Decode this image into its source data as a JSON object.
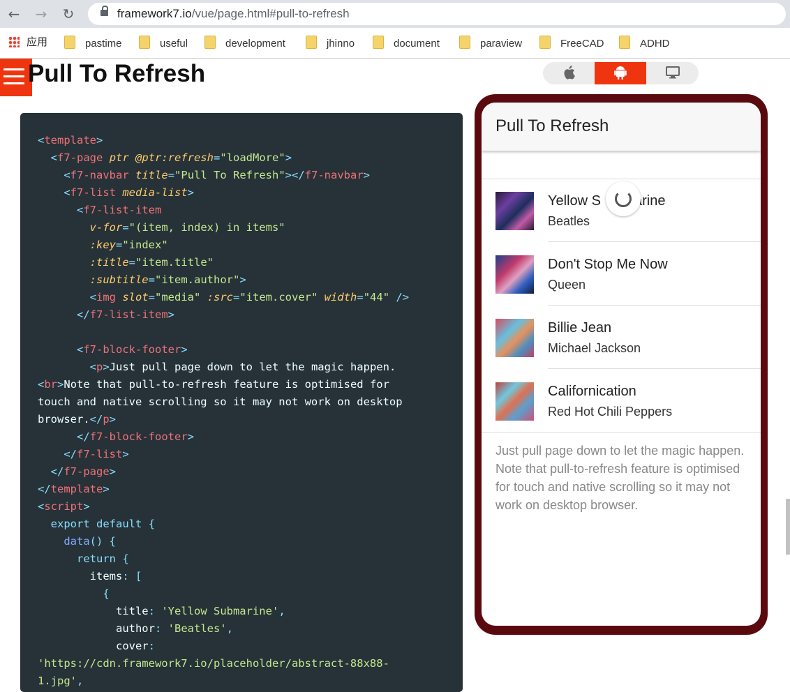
{
  "browser": {
    "url_host": "framework7.io",
    "url_path": "/vue/page.html#pull-to-refresh",
    "nav": {
      "back": "←",
      "forward": "→",
      "reload": "↻"
    }
  },
  "bookmarks": [
    {
      "label": "应用",
      "icon": "apps-grid-icon"
    },
    {
      "label": "pastime",
      "icon": "folder-icon"
    },
    {
      "label": "useful",
      "icon": "folder-icon"
    },
    {
      "label": "development",
      "icon": "folder-icon"
    },
    {
      "label": "jhinno",
      "icon": "folder-icon"
    },
    {
      "label": "document",
      "icon": "folder-icon"
    },
    {
      "label": "paraview",
      "icon": "folder-icon"
    },
    {
      "label": "FreeCAD",
      "icon": "folder-icon"
    },
    {
      "label": "ADHD",
      "icon": "folder-icon"
    }
  ],
  "page": {
    "title": "Pull To Refresh",
    "accent_color": "#ee350f"
  },
  "theme_switch": {
    "options": [
      {
        "label": "",
        "icon": "apple-icon",
        "active": false
      },
      {
        "label": "",
        "icon": "android-icon",
        "active": true
      },
      {
        "label": "",
        "icon": "desktop-icon",
        "active": false
      }
    ]
  },
  "demo": {
    "navbar_title": "Pull To Refresh",
    "items": [
      {
        "title": "Yellow S",
        "title_tail": "arine",
        "author": "Beatles"
      },
      {
        "title": "Don't Stop Me Now",
        "author": "Queen"
      },
      {
        "title": "Billie Jean",
        "author": "Michael Jackson"
      },
      {
        "title": "Californication",
        "author": "Red Hot Chili Peppers"
      }
    ],
    "footer_line1": "Just pull page down to let the magic happen.",
    "footer_line2": "Note that pull-to-refresh feature is optimised for touch and native scrolling so it may not work on desktop browser.",
    "frame_color": "#5a0a0f"
  }
}
